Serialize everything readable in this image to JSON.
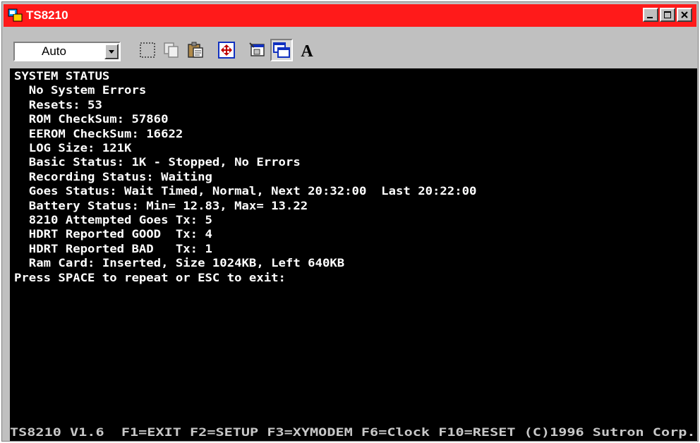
{
  "window": {
    "title": "TS8210"
  },
  "toolbar": {
    "font_size_value": "Auto",
    "tools": [
      "select-area",
      "copy",
      "paste",
      "full-screen",
      "properties",
      "background",
      "font"
    ]
  },
  "terminal": {
    "lines": [
      "SYSTEM STATUS",
      "  No System Errors",
      "  Resets: 53",
      "  ROM CheckSum: 57860",
      "  EEROM CheckSum: 16622",
      "  LOG Size: 121K",
      "  Basic Status: 1K - Stopped, No Errors",
      "  Recording Status: Waiting",
      "  Goes Status: Wait Timed, Normal, Next 20:32:00  Last 20:22:00",
      "  Battery Status: Min= 12.83, Max= 13.22",
      "  8210 Attempted Goes Tx: 5",
      "  HDRT Reported GOOD  Tx: 4",
      "  HDRT Reported BAD   Tx: 1",
      "  Ram Card: Inserted, Size 1024KB, Left 640KB",
      "Press SPACE to repeat or ESC to exit:"
    ]
  },
  "status_bar": {
    "text": "TS8210 V1.6  F1=EXIT F2=SETUP F3=XYMODEM F6=Clock F10=RESET (C)1996 Sutron Corp."
  },
  "colors": {
    "titlebar": "#ff1a1a",
    "terminal_bg": "#000000",
    "terminal_fg": "#ffffff"
  }
}
